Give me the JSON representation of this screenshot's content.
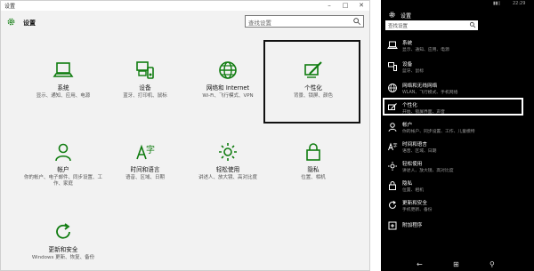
{
  "desktop": {
    "window_title": "设置",
    "header_title": "设置",
    "search_placeholder": "查找设置",
    "accent": "#107c10",
    "tiles": [
      {
        "icon": "laptop-icon",
        "label": "系统",
        "sub": "显示、通知、应用、电源"
      },
      {
        "icon": "devices-icon",
        "label": "设备",
        "sub": "蓝牙、打印机、鼠标"
      },
      {
        "icon": "globe-icon",
        "label": "网络和 Internet",
        "sub": "Wi-Fi、飞行模式、VPN"
      },
      {
        "icon": "paint-icon",
        "label": "个性化",
        "sub": "背景、锁屏、颜色"
      },
      {
        "icon": "person-icon",
        "label": "帐户",
        "sub": "你的帐户、电子邮件、同步设置、工作、家庭"
      },
      {
        "icon": "time-language-icon",
        "label": "时间和语言",
        "sub": "语音、区域、日期"
      },
      {
        "icon": "accessibility-icon",
        "label": "轻松使用",
        "sub": "讲述人、放大镜、高对比度"
      },
      {
        "icon": "lock-icon",
        "label": "隐私",
        "sub": "位置、相机"
      },
      {
        "icon": "update-icon",
        "label": "更新和安全",
        "sub": "Windows 更新、恢复、备份"
      }
    ]
  },
  "phone": {
    "time": "22:29",
    "title": "设置",
    "search_placeholder": "查找设置",
    "items": [
      {
        "icon": "phone-system-icon",
        "label": "系统",
        "sub": "显示、通知、应用、电源"
      },
      {
        "icon": "phone-devices-icon",
        "label": "设备",
        "sub": "蓝牙、鼠标"
      },
      {
        "icon": "phone-network-icon",
        "label": "网络和无线网络",
        "sub": "WLAN、飞行模式、手机网络"
      },
      {
        "icon": "phone-paint-icon",
        "label": "个性化",
        "sub": "开始、锁屏界面、声音"
      },
      {
        "icon": "phone-person-icon",
        "label": "帐户",
        "sub": "你的帐户、同步设置、工作、儿童模特"
      },
      {
        "icon": "phone-time-icon",
        "label": "时间和语言",
        "sub": "语音、区域、日期"
      },
      {
        "icon": "phone-access-icon",
        "label": "轻松使用",
        "sub": "讲述人、放大镜、高对比度"
      },
      {
        "icon": "phone-lock-icon",
        "label": "隐私",
        "sub": "位置、相机"
      },
      {
        "icon": "phone-update-icon",
        "label": "更新和安全",
        "sub": "手机更新、备份"
      },
      {
        "icon": "phone-extras-icon",
        "label": "附加程序",
        "sub": ""
      }
    ]
  }
}
